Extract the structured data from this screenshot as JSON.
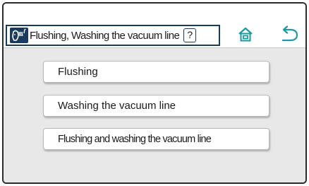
{
  "header": {
    "title": "Flushing, Washing the vacuum line",
    "help_label": "?",
    "icons": {
      "category": "cow-milk-icon",
      "home": "home-icon",
      "back": "back-arrow-icon"
    }
  },
  "menu": {
    "items": [
      {
        "label": "Flushing"
      },
      {
        "label": "Washing the vacuum line"
      },
      {
        "label": "Flushing and washing the vacuum line"
      }
    ]
  },
  "colors": {
    "accent": "#1a9aa0",
    "frame": "#1a3b5c",
    "content_bg": "#e8e8e8"
  }
}
